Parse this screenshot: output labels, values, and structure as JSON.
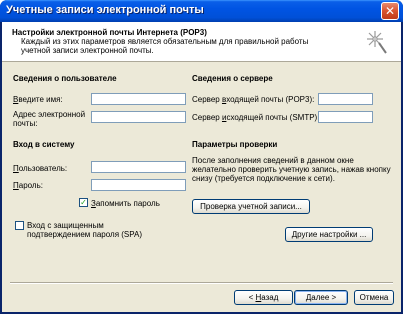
{
  "window": {
    "title": "Учетные записи электронной почты",
    "close_glyph": "✕"
  },
  "header": {
    "title": "Настройки электронной почты Интернета (POP3)",
    "description": "Каждый из этих параметров является обязательным для правильной работы учетной записи электронной почты.",
    "icon": "wizard-sparkle-icon"
  },
  "user_info": {
    "heading": "Сведения о пользователе",
    "name_label_u": "В",
    "name_label_rest": "ведите имя:",
    "name_value": "",
    "email_label_line1": "Адрес электронной",
    "email_label_line2": "почты:",
    "email_value": ""
  },
  "login": {
    "heading": "Вход в систему",
    "user_label_u": "П",
    "user_label_rest": "ользователь:",
    "user_value": "",
    "password_label_u": "П",
    "password_label_rest": "ароль:",
    "password_value": "",
    "remember_label_u": "З",
    "remember_label_rest": "апомнить пароль",
    "remember_checked": true,
    "spa_label_line1": "Вход с защищенным",
    "spa_label_line2": "подтверждением пароля (SPA)",
    "spa_checked": false
  },
  "server_info": {
    "heading": "Сведения о сервере",
    "incoming_label_pre": "Сервер ",
    "incoming_label_u": "в",
    "incoming_label_rest": "ходящей почты (POP3):",
    "incoming_value": "",
    "outgoing_label_pre": "Сервер ",
    "outgoing_label_u": "и",
    "outgoing_label_rest": "сходящей почты (SMTP):",
    "outgoing_value": ""
  },
  "test": {
    "heading": "Параметры проверки",
    "description": "После заполнения сведений в данном окне желательно проверить учетную запись, нажав кнопку снизу (требуется подключение к сети).",
    "test_button": "Проверка учетной записи...",
    "more_button": "Другие настройки ..."
  },
  "footer": {
    "back_button_u": "Н",
    "back_button_pre": "< ",
    "back_button_rest": "азад",
    "next_button_u": "Д",
    "next_button_rest": "алее >",
    "cancel_button": "Отмена"
  }
}
